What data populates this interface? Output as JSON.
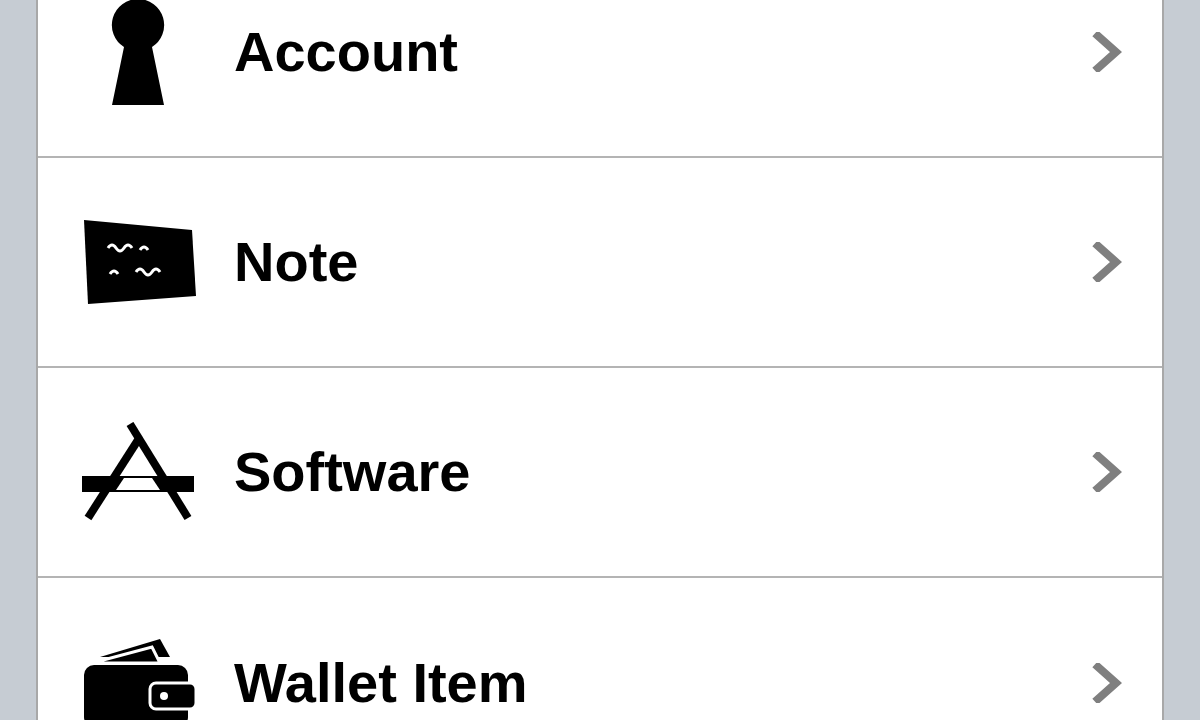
{
  "items": [
    {
      "kind": "account",
      "label": "Account"
    },
    {
      "kind": "note",
      "label": "Note"
    },
    {
      "kind": "software",
      "label": "Software"
    },
    {
      "kind": "wallet",
      "label": "Wallet Item"
    }
  ]
}
